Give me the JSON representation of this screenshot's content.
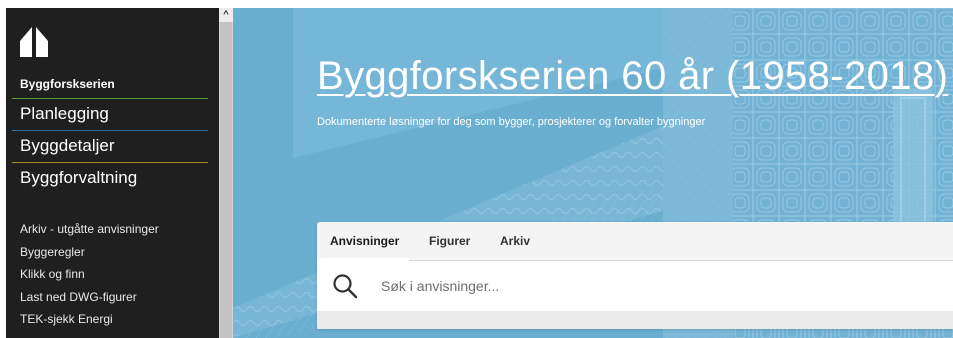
{
  "sidebar": {
    "logo_icon": "house-icon",
    "brand": "Byggforskserien",
    "main_items": [
      {
        "label": "Planlegging",
        "accent": "#5a9c3c"
      },
      {
        "label": "Byggdetaljer",
        "accent": "#2e6fa0"
      },
      {
        "label": "Byggforvaltning",
        "accent": "#a68c2e"
      }
    ],
    "sub_items": [
      {
        "label": "Arkiv - utgåtte anvisninger"
      },
      {
        "label": "Byggeregler"
      },
      {
        "label": "Klikk og finn"
      },
      {
        "label": "Last ned DWG-figurer"
      },
      {
        "label": "TEK-sjekk Energi"
      }
    ]
  },
  "scrollbar": {
    "up_arrow": "^"
  },
  "hero": {
    "title": "Byggforskserien 60 år (1958-2018)",
    "subtitle": "Dokumenterte løsninger for deg som bygger, prosjekterer og forvalter bygninger",
    "background_color": "#6aaed0"
  },
  "search": {
    "tabs": [
      {
        "label": "Anvisninger",
        "active": true
      },
      {
        "label": "Figurer",
        "active": false
      },
      {
        "label": "Arkiv",
        "active": false
      }
    ],
    "icon": "search-icon",
    "placeholder": "Søk i anvisninger..."
  }
}
